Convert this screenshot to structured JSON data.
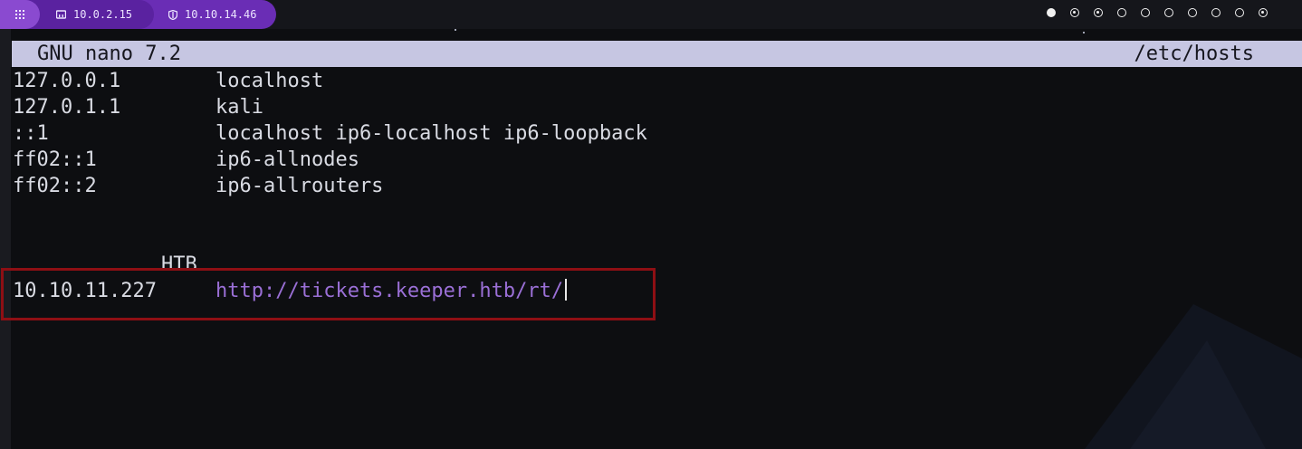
{
  "topbar": {
    "launcher_icon": "grid-icon",
    "items": [
      {
        "icon": "ethernet-icon",
        "label": "10.0.2.15"
      },
      {
        "icon": "vpn-shield-icon",
        "label": "10.10.14.46"
      }
    ],
    "workspaces": [
      "filled",
      "dot",
      "dot",
      "empty",
      "empty",
      "empty",
      "empty",
      "empty",
      "empty",
      "dot"
    ]
  },
  "editor": {
    "app": "GNU nano 7.2",
    "file": "/etc/hosts",
    "lines": [
      {
        "addr": "127.0.0.1",
        "host": "localhost"
      },
      {
        "addr": "127.0.1.1",
        "host": "kali"
      },
      {
        "addr": "::1",
        "host": "localhost ip6-localhost ip6-loopback"
      },
      {
        "addr": "ff02::1",
        "host": "ip6-allnodes"
      },
      {
        "addr": "ff02::2",
        "host": "ip6-allrouters"
      }
    ],
    "comment": "HTB",
    "highlighted": {
      "addr": "10.10.11.227",
      "host": "http://tickets.keeper.htb/rt/"
    }
  },
  "colors": {
    "accent": "#6a2db5",
    "titlebar": "#c6c6e2",
    "link": "#9a6fd6",
    "highlight_border": "#8e0f14"
  }
}
